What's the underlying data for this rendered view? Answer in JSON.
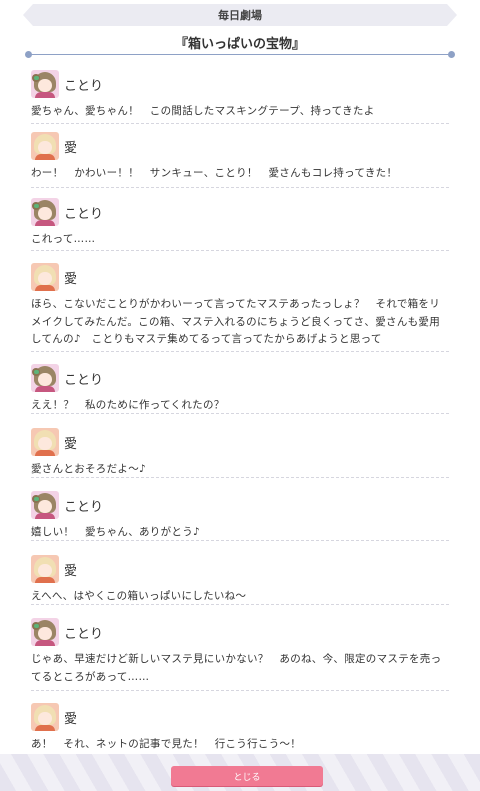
{
  "header": {
    "label": "毎日劇場"
  },
  "episode": {
    "title": "『箱いっぱいの宝物』"
  },
  "dialogue": [
    {
      "speaker": "ことり",
      "avatar": "kotori",
      "text": "愛ちゃん、愛ちゃん！　この間話したマスキングテープ、持ってきたよ"
    },
    {
      "speaker": "愛",
      "avatar": "ai",
      "text": "わー！　かわいー！！　サンキュー、ことり！　愛さんもコレ持ってきた！"
    },
    {
      "speaker": "ことり",
      "avatar": "kotori",
      "text": "これって……"
    },
    {
      "speaker": "愛",
      "avatar": "ai",
      "text": "ほら、こないだことりがかわいーって言ってたマステあったっしょ？　それで箱をリメイクしてみたんだ。この箱、マステ入れるのにちょうど良くってさ、愛さんも愛用してんの♪　ことりもマステ集めてるって言ってたからあげようと思って"
    },
    {
      "speaker": "ことり",
      "avatar": "kotori",
      "text": "ええ！？　私のために作ってくれたの？"
    },
    {
      "speaker": "愛",
      "avatar": "ai",
      "text": "愛さんとおそろだよ～♪"
    },
    {
      "speaker": "ことり",
      "avatar": "kotori",
      "text": "嬉しい！　愛ちゃん、ありがとう♪"
    },
    {
      "speaker": "愛",
      "avatar": "ai",
      "text": "えへへ、はやくこの箱いっぱいにしたいね～"
    },
    {
      "speaker": "ことり",
      "avatar": "kotori",
      "text": "じゃあ、早速だけど新しいマステ見にいかない？　あのね、今、限定のマステを売ってるところがあって……"
    },
    {
      "speaker": "愛",
      "avatar": "ai",
      "text": "あ！　それ、ネットの記事で見た！　行こう行こう～！"
    }
  ],
  "footer": {
    "close_label": "とじる"
  },
  "colors": {
    "accent_button": "#f17a93",
    "divider": "#8ea1c6",
    "header_bg": "#ebebf2"
  }
}
